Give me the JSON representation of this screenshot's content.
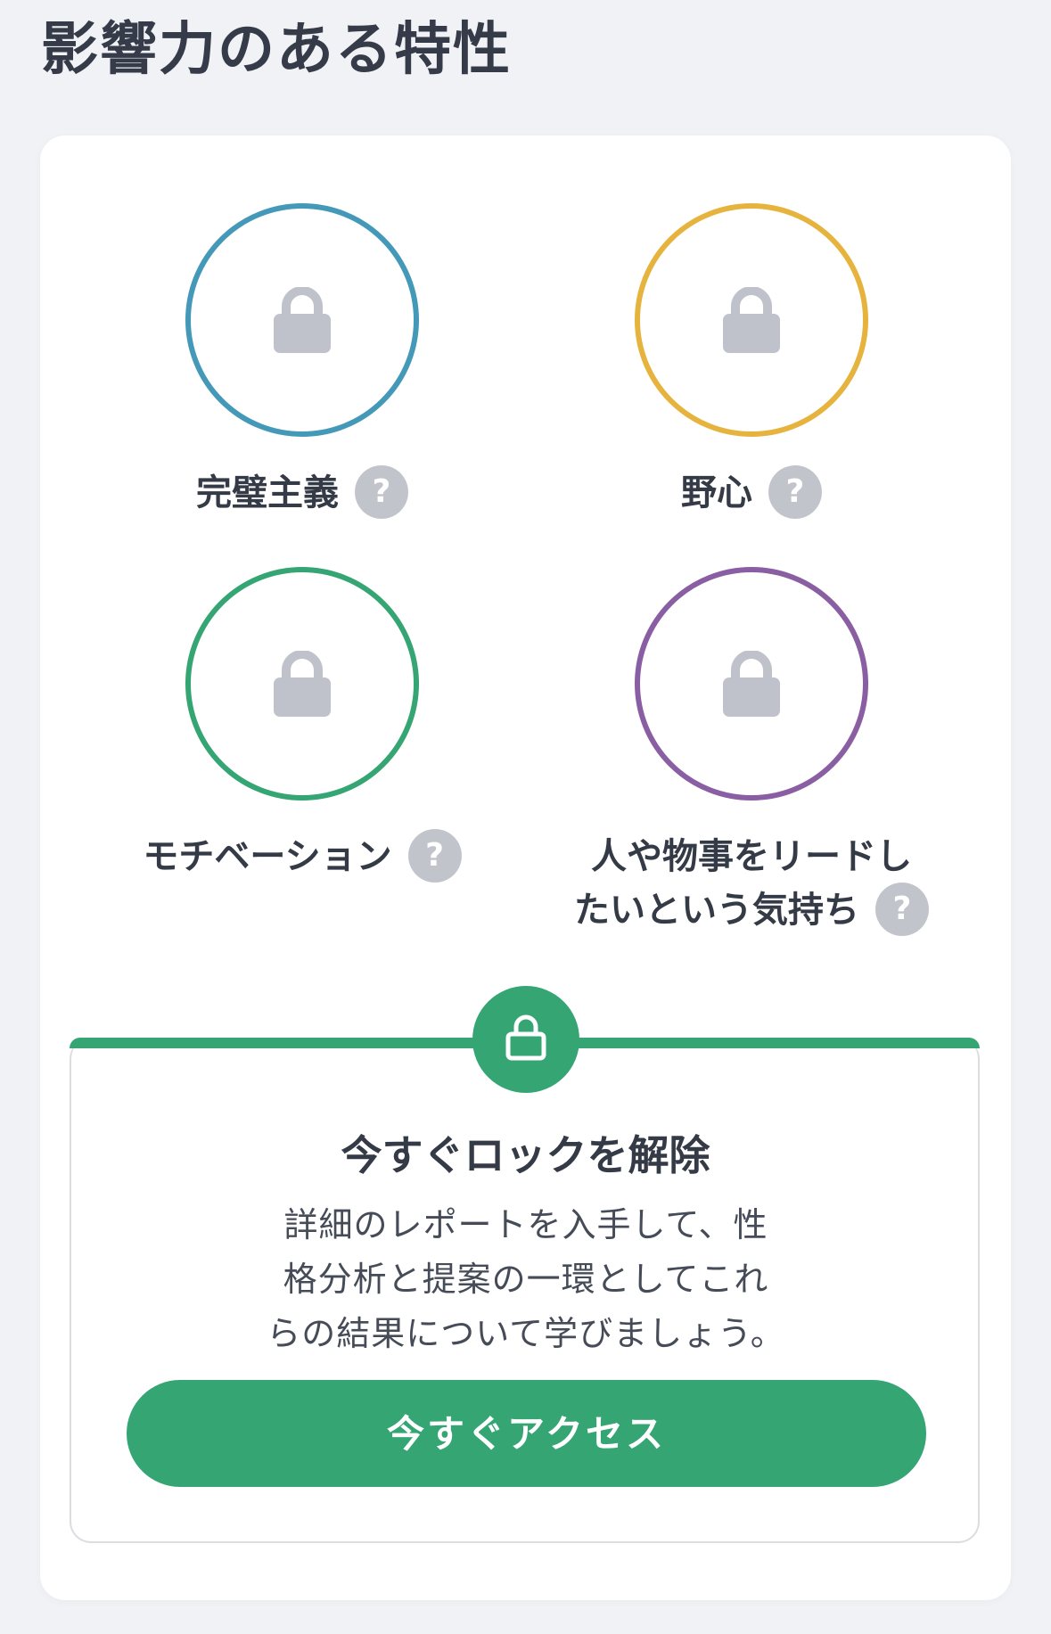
{
  "page": {
    "title": "影響力のある特性"
  },
  "traits": [
    {
      "label": "完璧主義",
      "color": "#4499b8",
      "help_icon": "?",
      "icon": "lock-icon"
    },
    {
      "label": "野心",
      "color": "#e6b43e",
      "help_icon": "?",
      "icon": "lock-icon"
    },
    {
      "label": "モチベーション",
      "color": "#35a574",
      "help_icon": "?",
      "icon": "lock-icon"
    },
    {
      "label_line1": "人や物事をリードし",
      "label_line2": "たいという気持ち",
      "color": "#8a5ea3",
      "help_icon": "?",
      "icon": "lock-icon"
    }
  ],
  "unlock": {
    "title": "今すぐロックを解除",
    "description_line1": "詳細のレポートを入手して、性",
    "description_line2": "格分析と提案の一環としてこれ",
    "description_line3": "らの結果について学びましょう。",
    "button_label": "今すぐアクセス",
    "accent_color": "#35a574",
    "icon": "open-lock-icon"
  }
}
